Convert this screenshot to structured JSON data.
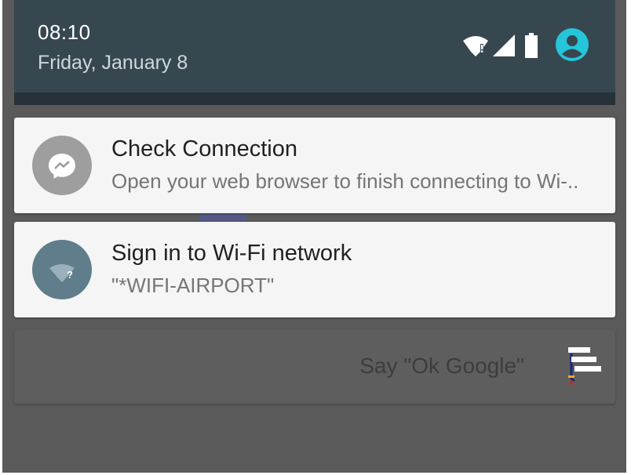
{
  "status_bar": {
    "time": "08:10",
    "date": "Friday, January 8",
    "icons": [
      "wifi-warning-icon",
      "cell-signal-icon",
      "battery-icon",
      "user-avatar-icon"
    ],
    "accent_color": "#26c6da"
  },
  "notifications": [
    {
      "app_icon": "messenger-icon",
      "title": "Check Connection",
      "body": "Open your web browser to finish connecting to Wi-.."
    },
    {
      "app_icon": "wifi-question-icon",
      "title": "Sign in to Wi-Fi network",
      "body": "\"*WIFI-AIRPORT\""
    }
  ],
  "search": {
    "hint": "Say \"Ok Google\"",
    "icon": "google-now-icon"
  },
  "colors": {
    "header_bg": "#37474f",
    "card_bg": "#f5f5f5",
    "messenger_icon_bg": "#9e9e9e",
    "wifi_icon_bg": "#607d8b"
  }
}
